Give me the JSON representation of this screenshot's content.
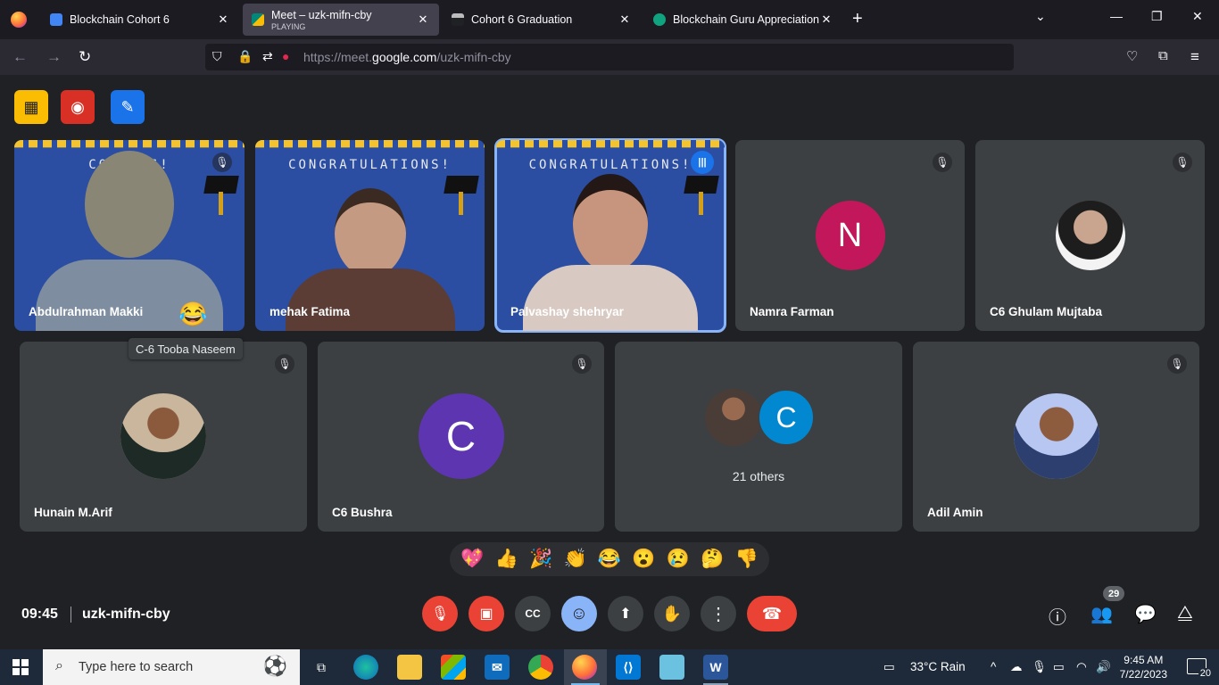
{
  "browser": {
    "tabs": [
      {
        "title": "Blockchain Cohort 6",
        "subtitle": "",
        "active": false,
        "favicon_color": "#4285f4"
      },
      {
        "title": "Meet – uzk-mifn-cby",
        "subtitle": "PLAYING",
        "active": true,
        "favicon_color": "#00897b"
      },
      {
        "title": "Cohort 6 Graduation",
        "subtitle": "",
        "active": false,
        "favicon_color": "#202124"
      },
      {
        "title": "Blockchain Guru Appreciation",
        "subtitle": "",
        "active": false,
        "favicon_color": "#10a37f"
      }
    ],
    "url_prefix": "https://meet.",
    "url_domain": "google.com",
    "url_path": "/uzk-mifn-cby"
  },
  "meet": {
    "congrats_text": "CONGRATULATIONS!",
    "congrats_text_partial": "CONG        NS!",
    "tooltip": "C-6 Tooba Naseem",
    "participants": [
      {
        "name": "Abdulrahman Makki",
        "kind": "video",
        "muted": true,
        "reaction": "😂"
      },
      {
        "name": "mehak Fatima",
        "kind": "video",
        "muted": false
      },
      {
        "name": "Palvashay shehryar",
        "kind": "video",
        "speaking": true
      },
      {
        "name": "Namra Farman",
        "kind": "initial",
        "initial": "N",
        "color": "#c2185b",
        "muted": true
      },
      {
        "name": "C6 Ghulam Mujtaba",
        "kind": "photo",
        "muted": true
      },
      {
        "name": "Hunain M.Arif",
        "kind": "photo",
        "muted": true
      },
      {
        "name": "C6 Bushra",
        "kind": "initial",
        "initial": "C",
        "color": "#5e35b1",
        "muted": true
      },
      {
        "name": "Adil Amin",
        "kind": "photo",
        "muted": true
      }
    ],
    "others": {
      "label": "21 others",
      "initial": "C",
      "color": "#0288d1"
    },
    "reactions": [
      "💖",
      "👍",
      "🎉",
      "👏",
      "😂",
      "😮",
      "😢",
      "🤔",
      "👎"
    ],
    "time": "09:45",
    "meeting_code": "uzk-mifn-cby",
    "people_count": "29"
  },
  "taskbar": {
    "search_placeholder": "Type here to search",
    "weather": "33°C  Rain",
    "time": "9:45 AM",
    "date": "7/22/2023",
    "notifications": "20"
  }
}
